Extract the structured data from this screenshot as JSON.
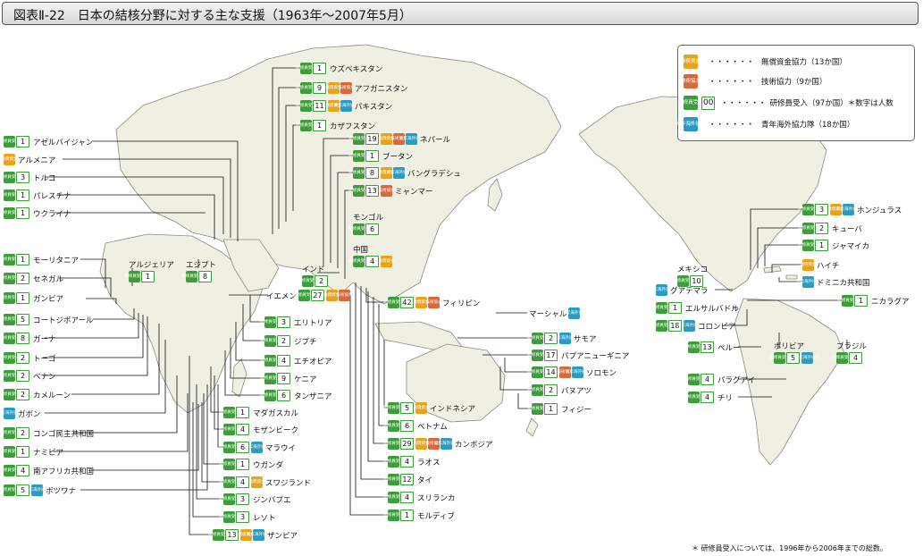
{
  "title": "図表Ⅱ-22　日本の結核分野に対する主な支援（1963年〜2007年5月）",
  "tags": {
    "grant": "無償資金",
    "tech": "技術協力",
    "trainee": "研修員受入",
    "jocv": "青年海外協力"
  },
  "legend": {
    "grant": "無償資金協力（13か国）",
    "tech": "技術協力（9か国）",
    "trainee_sample": "00",
    "trainee": "研修員受入（97か国）＊数字は人数",
    "jocv": "青年海外協力隊（18か国）",
    "dots": "・・・・・・"
  },
  "colors": {
    "trainee": "#3f9b3c",
    "grant": "#e8a319",
    "tech": "#d9693b",
    "jocv": "#2b9bc2",
    "land": "#efefe4",
    "coast": "#8a8a80"
  },
  "countries": [
    {
      "name": "アゼルバイジャン",
      "count": "1",
      "types": []
    },
    {
      "name": "アルメニア",
      "count": "",
      "types": [
        "grant"
      ]
    },
    {
      "name": "トルコ",
      "count": "3",
      "types": []
    },
    {
      "name": "パレスチナ",
      "count": "1",
      "types": []
    },
    {
      "name": "ウクライナ",
      "count": "1",
      "types": []
    },
    {
      "name": "モーリタニア",
      "count": "1",
      "types": []
    },
    {
      "name": "セネガル",
      "count": "2",
      "types": []
    },
    {
      "name": "ガンビア",
      "count": "1",
      "types": []
    },
    {
      "name": "コートジボアール",
      "count": "5",
      "types": []
    },
    {
      "name": "ガーナ",
      "count": "8",
      "types": []
    },
    {
      "name": "トーゴ",
      "count": "2",
      "types": []
    },
    {
      "name": "ベナン",
      "count": "2",
      "types": []
    },
    {
      "name": "カメルーン",
      "count": "2",
      "types": []
    },
    {
      "name": "ガボン",
      "count": "",
      "types": [
        "jocv"
      ]
    },
    {
      "name": "コンゴ民主共和国",
      "count": "2",
      "types": []
    },
    {
      "name": "ナミビア",
      "count": "1",
      "types": []
    },
    {
      "name": "南アフリカ共和国",
      "count": "4",
      "types": []
    },
    {
      "name": "ボツワナ",
      "count": "5",
      "types": [
        "jocv"
      ]
    },
    {
      "name": "アルジェリア",
      "count": "1",
      "types": []
    },
    {
      "name": "エジプト",
      "count": "8",
      "types": []
    },
    {
      "name": "ウズベキスタン",
      "count": "1",
      "types": []
    },
    {
      "name": "アフガニスタン",
      "count": "9",
      "types": [
        "grant",
        "tech"
      ]
    },
    {
      "name": "パキスタン",
      "count": "11",
      "types": [
        "grant",
        "jocv"
      ]
    },
    {
      "name": "カザフスタン",
      "count": "1",
      "types": []
    },
    {
      "name": "ネパール",
      "count": "19",
      "types": [
        "grant",
        "tech",
        "jocv"
      ]
    },
    {
      "name": "ブータン",
      "count": "1",
      "types": []
    },
    {
      "name": "バングラデシュ",
      "count": "8",
      "types": [
        "grant",
        "jocv"
      ]
    },
    {
      "name": "ミャンマー",
      "count": "13",
      "types": [
        "tech"
      ]
    },
    {
      "name": "モンゴル",
      "count": "6",
      "types": []
    },
    {
      "name": "中国",
      "count": "4",
      "types": [
        "grant"
      ]
    },
    {
      "name": "インド",
      "count": "2",
      "types": []
    },
    {
      "name": "イエメン",
      "count": "27",
      "types": [
        "grant",
        "tech"
      ]
    },
    {
      "name": "エリトリア",
      "count": "3",
      "types": []
    },
    {
      "name": "ジブチ",
      "count": "2",
      "types": []
    },
    {
      "name": "エチオピア",
      "count": "4",
      "types": []
    },
    {
      "name": "ケニア",
      "count": "9",
      "types": []
    },
    {
      "name": "タンザニア",
      "count": "6",
      "types": []
    },
    {
      "name": "マダガスカル",
      "count": "1",
      "types": []
    },
    {
      "name": "モザンビーク",
      "count": "4",
      "types": []
    },
    {
      "name": "マラウイ",
      "count": "6",
      "types": [
        "jocv"
      ]
    },
    {
      "name": "ウガンダ",
      "count": "1",
      "types": []
    },
    {
      "name": "スワジランド",
      "count": "4",
      "types": [
        "grant"
      ]
    },
    {
      "name": "ジンバブエ",
      "count": "3",
      "types": []
    },
    {
      "name": "レソト",
      "count": "3",
      "types": []
    },
    {
      "name": "ザンビア",
      "count": "13",
      "types": [
        "grant",
        "jocv"
      ]
    },
    {
      "name": "フィリピン",
      "count": "42",
      "types": [
        "grant",
        "tech"
      ]
    },
    {
      "name": "マーシャル",
      "count": "",
      "types": [
        "jocv"
      ]
    },
    {
      "name": "サモア",
      "count": "2",
      "types": [
        "jocv"
      ]
    },
    {
      "name": "パプアニューギニア",
      "count": "17",
      "types": []
    },
    {
      "name": "ソロモン",
      "count": "14",
      "types": [
        "tech",
        "jocv"
      ]
    },
    {
      "name": "バヌアツ",
      "count": "2",
      "types": []
    },
    {
      "name": "フィジー",
      "count": "1",
      "types": []
    },
    {
      "name": "インドネシア",
      "count": "5",
      "types": [
        "grant"
      ]
    },
    {
      "name": "ベトナム",
      "count": "6",
      "types": []
    },
    {
      "name": "カンボジア",
      "count": "29",
      "types": [
        "grant",
        "tech",
        "jocv"
      ]
    },
    {
      "name": "ラオス",
      "count": "4",
      "types": []
    },
    {
      "name": "タイ",
      "count": "12",
      "types": []
    },
    {
      "name": "スリランカ",
      "count": "4",
      "types": []
    },
    {
      "name": "モルディブ",
      "count": "1",
      "types": []
    },
    {
      "name": "ホンジュラス",
      "count": "3",
      "types": [
        "grant",
        "jocv"
      ]
    },
    {
      "name": "キューバ",
      "count": "2",
      "types": []
    },
    {
      "name": "ジャマイカ",
      "count": "1",
      "types": []
    },
    {
      "name": "ハイチ",
      "count": "",
      "types": [
        "grant"
      ]
    },
    {
      "name": "ドミニカ共和国",
      "count": "",
      "types": [
        "jocv"
      ]
    },
    {
      "name": "ニカラグア",
      "count": "1",
      "types": []
    },
    {
      "name": "メキシコ",
      "count": "10",
      "types": []
    },
    {
      "name": "グアテマラ",
      "count": "",
      "types": [
        "jocv"
      ]
    },
    {
      "name": "エルサルバドル",
      "count": "1",
      "types": []
    },
    {
      "name": "コロンビア",
      "count": "18",
      "types": [
        "jocv"
      ]
    },
    {
      "name": "ペルー",
      "count": "13",
      "types": []
    },
    {
      "name": "ボリビア",
      "count": "5",
      "types": [
        "jocv"
      ]
    },
    {
      "name": "ブラジル",
      "count": "4",
      "types": []
    },
    {
      "name": "パラグアイ",
      "count": "4",
      "types": []
    },
    {
      "name": "チリ",
      "count": "4",
      "types": []
    }
  ],
  "footnote": "＊ 研修員受入については、1996年から2006年までの総数。"
}
